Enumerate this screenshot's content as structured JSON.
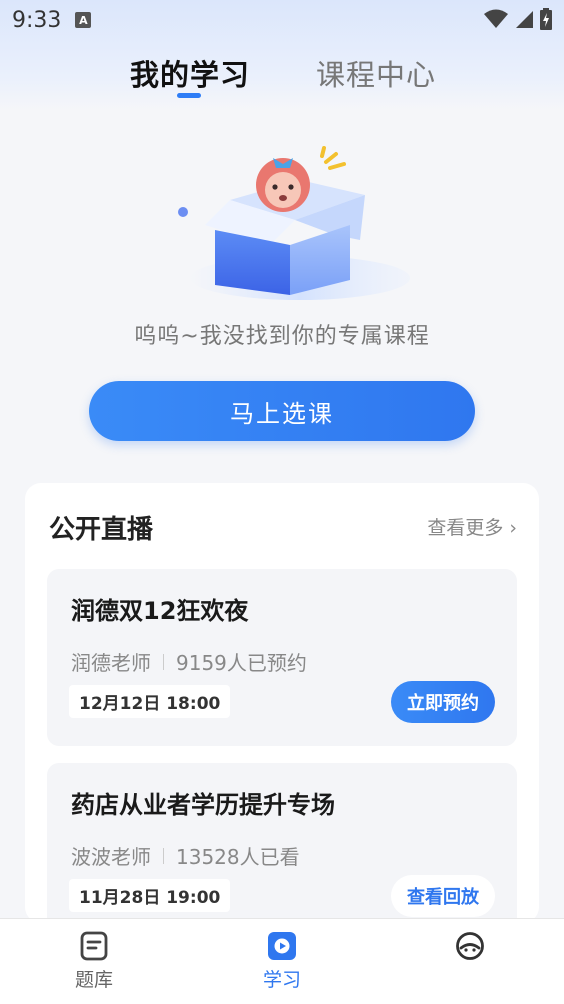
{
  "status_bar": {
    "time": "9:33",
    "a_badge": "A"
  },
  "tabs": [
    {
      "label": "我的学习",
      "active": true
    },
    {
      "label": "课程中心",
      "active": false
    }
  ],
  "empty_state": {
    "message": "呜呜~我没找到你的专属课程",
    "button_label": "马上选课"
  },
  "live_section": {
    "title": "公开直播",
    "more_label": "查看更多 ›",
    "courses": [
      {
        "name": "润德双12狂欢夜",
        "teacher": "润德老师",
        "stat": "9159人已预约",
        "date": "12月12日 18:00",
        "action": "立即预约"
      },
      {
        "name": "药店从业者学历提升专场",
        "teacher": "波波老师",
        "stat": "13528人已看",
        "date": "11月28日 19:00",
        "action": "查看回放"
      }
    ]
  },
  "bottom_nav": [
    {
      "label": "题库",
      "icon": "question-bank-icon",
      "active": false
    },
    {
      "label": "学习",
      "icon": "study-play-icon",
      "active": true
    },
    {
      "label": "",
      "icon": "profile-face-icon",
      "active": false
    }
  ],
  "colors": {
    "accent": "#2f77ef",
    "background": "#f5f6f9"
  }
}
